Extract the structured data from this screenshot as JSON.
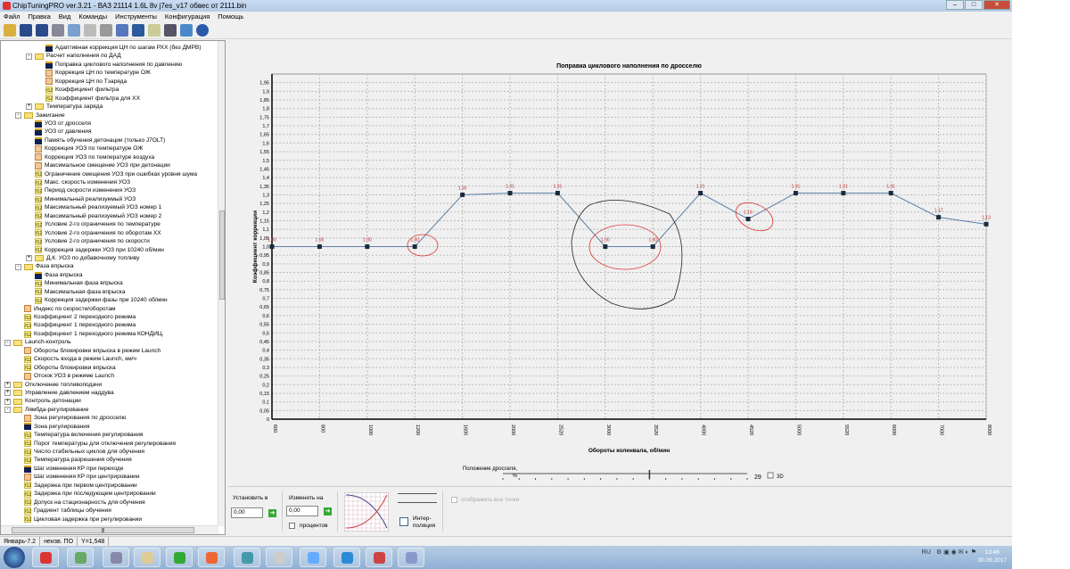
{
  "window": {
    "title": "ChipTuningPRO ver.3.21 - ВАЗ 21114 1.6L 8v  j7es_v17 обвес от 2111.bin"
  },
  "menu": [
    "Файл",
    "Правка",
    "Вид",
    "Команды",
    "Инструменты",
    "Конфигурация",
    "Помощь"
  ],
  "toolbar": [
    "open-icon",
    "save-icon",
    "save-as-icon",
    "print-icon",
    "copy-icon",
    "paste-icon",
    "undo-icon",
    "edit-icon",
    "diamond-icon",
    "search-icon",
    "tool-icon",
    "network-icon",
    "help-icon"
  ],
  "tree": [
    {
      "l": 3,
      "t": "map",
      "x": "",
      "label": "Адаптивная коррекция ЦН по шагам РХХ (без ДМРВ)"
    },
    {
      "l": 2,
      "t": "folder",
      "x": "-",
      "label": "Расчет наполнения по ДАД"
    },
    {
      "l": 3,
      "t": "map",
      "x": "",
      "label": "Поправка циклового наполнения по давлению"
    },
    {
      "l": 3,
      "t": "graph",
      "x": "",
      "label": "Коррекция ЦН по температуре ОЖ"
    },
    {
      "l": 3,
      "t": "graph",
      "x": "",
      "label": "Коррекция ЦН по Тзаряда"
    },
    {
      "l": 3,
      "t": "const",
      "x": "",
      "label": "Коэффициент фильтра"
    },
    {
      "l": 3,
      "t": "const",
      "x": "",
      "label": "Коэффициент фильтра для ХХ"
    },
    {
      "l": 2,
      "t": "folder",
      "x": "+",
      "label": "Температура заряда"
    },
    {
      "l": 1,
      "t": "folder",
      "x": "-",
      "label": "Зажигание"
    },
    {
      "l": 2,
      "t": "map",
      "x": "",
      "label": "УОЗ от дросселя"
    },
    {
      "l": 2,
      "t": "map",
      "x": "",
      "label": "УОЗ от давления"
    },
    {
      "l": 2,
      "t": "map",
      "x": "",
      "label": "Память обучения детонации (только J7OLT)"
    },
    {
      "l": 2,
      "t": "graph",
      "x": "",
      "label": "Коррекция УОЗ по температуре ОЖ"
    },
    {
      "l": 2,
      "t": "graph",
      "x": "",
      "label": "Коррекция УОЗ по температуре воздуха"
    },
    {
      "l": 2,
      "t": "graph",
      "x": "",
      "label": "Максимальное смещение УОЗ при детонации"
    },
    {
      "l": 2,
      "t": "const",
      "x": "",
      "label": "Ограничение смещения УОЗ при ошибках уровня шума"
    },
    {
      "l": 2,
      "t": "const",
      "x": "",
      "label": "Макс. скорость изменения УОЗ"
    },
    {
      "l": 2,
      "t": "const",
      "x": "",
      "label": "Период скорости изменения УОЗ"
    },
    {
      "l": 2,
      "t": "const",
      "x": "",
      "label": "Минимальный реализуемый УОЗ"
    },
    {
      "l": 2,
      "t": "const",
      "x": "",
      "label": "Максимальный реализуемый УОЗ номер 1"
    },
    {
      "l": 2,
      "t": "const",
      "x": "",
      "label": "Максимальный реализуемый УОЗ номер 2"
    },
    {
      "l": 2,
      "t": "const",
      "x": "",
      "label": "Условие 2-го ограничения по температуре"
    },
    {
      "l": 2,
      "t": "const",
      "x": "",
      "label": "Условие 2-го ограничения по оборотам ХХ"
    },
    {
      "l": 2,
      "t": "const",
      "x": "",
      "label": "Условие 2-го ограничения по скорости"
    },
    {
      "l": 2,
      "t": "const",
      "x": "",
      "label": "Коррекция задержки УОЗ при 10240 об/мин"
    },
    {
      "l": 2,
      "t": "folder",
      "x": "+",
      "label": "Д.К. УОЗ по добавочному топливу"
    },
    {
      "l": 1,
      "t": "folder",
      "x": "-",
      "label": "Фаза впрыска"
    },
    {
      "l": 2,
      "t": "map",
      "x": "",
      "label": "Фаза впрыска"
    },
    {
      "l": 2,
      "t": "const",
      "x": "",
      "label": "Минимальная фаза впрыска"
    },
    {
      "l": 2,
      "t": "const",
      "x": "",
      "label": "Максимальная фаза впрыска"
    },
    {
      "l": 2,
      "t": "const",
      "x": "",
      "label": "Коррекция задержки фазы при 10240 об/мин"
    },
    {
      "l": 1,
      "t": "graph",
      "x": "",
      "label": "Индекс по скорости/оборотам"
    },
    {
      "l": 1,
      "t": "const",
      "x": "",
      "label": "Коэффициент 2 переходного режима"
    },
    {
      "l": 1,
      "t": "const",
      "x": "",
      "label": "Коэффициент 1 переходного режима"
    },
    {
      "l": 1,
      "t": "const",
      "x": "",
      "label": "Коэффициент 1 переходного режима КОНДИЦ."
    },
    {
      "l": 0,
      "t": "folder",
      "x": "-",
      "label": "Launch-контроль"
    },
    {
      "l": 1,
      "t": "graph",
      "x": "",
      "label": "Обороты блокировки впрыска в режим Launch"
    },
    {
      "l": 1,
      "t": "const",
      "x": "",
      "label": "Скорость входа в режим Launch, км/ч"
    },
    {
      "l": 1,
      "t": "const",
      "x": "",
      "label": "Обороты блокировки впрыска"
    },
    {
      "l": 1,
      "t": "graph",
      "x": "",
      "label": "Отскок УОЗ в режиме Launch"
    },
    {
      "l": 0,
      "t": "folder",
      "x": "+",
      "label": "Отключение топливоподачи"
    },
    {
      "l": 0,
      "t": "folder",
      "x": "+",
      "label": "Управление давлением наддува"
    },
    {
      "l": 0,
      "t": "folder",
      "x": "+",
      "label": "Контроль детонации"
    },
    {
      "l": 0,
      "t": "folder",
      "x": "-",
      "label": "Лямбда-регулирование"
    },
    {
      "l": 1,
      "t": "graph",
      "x": "",
      "label": "Зона регулирования по дросселю"
    },
    {
      "l": 1,
      "t": "map",
      "x": "",
      "label": "Зона регулирования"
    },
    {
      "l": 1,
      "t": "const",
      "x": "",
      "label": "Температура включения регулирования"
    },
    {
      "l": 1,
      "t": "const",
      "x": "",
      "label": "Порог температуры для отключения регулирования"
    },
    {
      "l": 1,
      "t": "const",
      "x": "",
      "label": "Число стабильных циклов для обучения"
    },
    {
      "l": 1,
      "t": "const",
      "x": "",
      "label": "Температура разрешения обучения"
    },
    {
      "l": 1,
      "t": "map",
      "x": "",
      "label": "Шаг изменения КР при переходе"
    },
    {
      "l": 1,
      "t": "graph",
      "x": "",
      "label": "Шаг изменения КР при центрировании"
    },
    {
      "l": 1,
      "t": "const",
      "x": "",
      "label": "Задержка при первом центрировании"
    },
    {
      "l": 1,
      "t": "const",
      "x": "",
      "label": "Задержка при последующем центрировании"
    },
    {
      "l": 1,
      "t": "const",
      "x": "",
      "label": "Допуск на стационарность для обучения"
    },
    {
      "l": 1,
      "t": "const",
      "x": "",
      "label": "Градиент таблицы обучения"
    },
    {
      "l": 1,
      "t": "const",
      "x": "",
      "label": "Цикловая задержка при регулировании"
    }
  ],
  "icon_text": {
    "const": "f12"
  },
  "status": [
    "Январь-7.2",
    "неизв. ПО",
    "Y=1,548"
  ],
  "chart_data": {
    "type": "line",
    "title": "Поправка циклового наполнения по дросселю",
    "xlabel": "Обороты коленвала, об/мин",
    "ylabel": "Коэффициент коррекции",
    "categories": [
      "600",
      "800",
      "1000",
      "1200",
      "1600",
      "2000",
      "2520",
      "3000",
      "3520",
      "4000",
      "4520",
      "5000",
      "5520",
      "6000",
      "7000",
      "8000"
    ],
    "values": [
      1.0,
      1.0,
      1.0,
      1.0,
      1.3,
      1.31,
      1.31,
      1.0,
      1.0,
      1.31,
      1.16,
      1.31,
      1.31,
      1.31,
      1.17,
      1.13
    ],
    "labels": [
      "1.00",
      "1.00",
      "1.00",
      "1.00",
      "1.30",
      "1.31",
      "1.31",
      "1.00",
      "1.00",
      "1.31",
      "1.16",
      "1.31",
      "1.31",
      "1.31",
      "1.17",
      "1.13"
    ],
    "ylim": [
      0,
      2.0
    ],
    "ystep": 0.05,
    "grid": true,
    "line_color": "#5b7fa6",
    "marker_color": "#1a2a40",
    "label_color": "#c03030"
  },
  "throttle": {
    "label": "Положение дросселя,",
    "unit": "%",
    "value": "29",
    "value_fraction": 0.6,
    "check_label": "3D"
  },
  "bottom": {
    "set_label": "Установить в",
    "set_value": "0,00",
    "change_label": "Изменить на",
    "change_value": "0,00",
    "percent_label": "процентов",
    "interp_label1": "Интер-",
    "interp_label2": "поляция",
    "show_all_label": "отображать все точки"
  },
  "taskbar": {
    "lang": "RU",
    "time": "13:46",
    "date": "30.09.2017"
  }
}
